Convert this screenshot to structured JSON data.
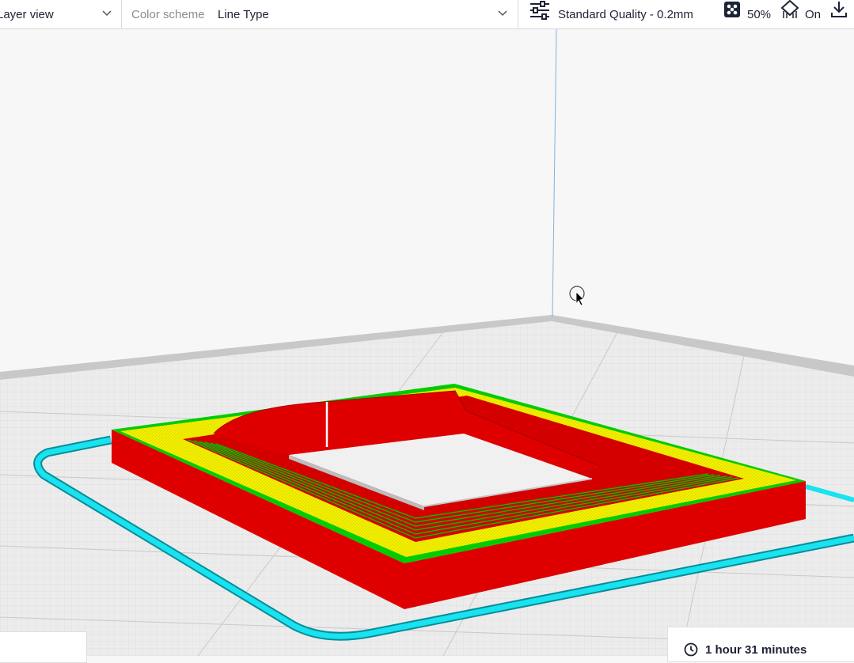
{
  "toolbar": {
    "view_mode": "Layer view",
    "color_scheme_label": "Color scheme",
    "color_scheme_value": "Line Type",
    "quality": "Standard Quality - 0.2mm",
    "infill": "50%",
    "support": "On"
  },
  "status": {
    "print_time": "1 hour 31 minutes"
  },
  "colors": {
    "wall_outer": "#e00000",
    "wall_inner": "#00c800",
    "skin": "#f0f000",
    "skirt": "#00e0e0",
    "accent": "#1d2235"
  },
  "icons": [
    "chevron-down-icon",
    "settings-sliders-icon",
    "infill-icon",
    "support-icon",
    "download-icon",
    "clock-icon",
    "cursor-icon"
  ]
}
